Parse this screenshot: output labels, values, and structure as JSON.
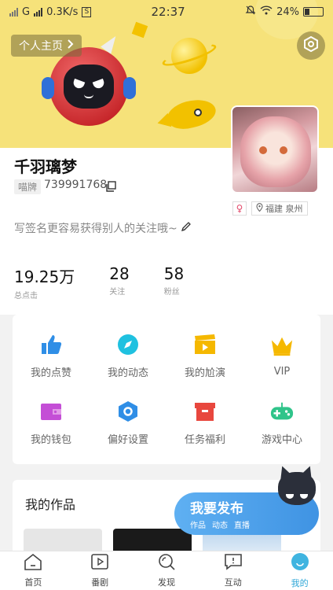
{
  "status_bar": {
    "network": "G",
    "speed": "0.3K/s",
    "s_badge": "S",
    "time": "22:37",
    "battery": "24%",
    "icons": [
      "signal-icon",
      "mute-bell-icon",
      "wifi-icon",
      "battery-icon"
    ]
  },
  "header": {
    "home_label": "个人主页",
    "settings_icon": "gear-icon"
  },
  "profile": {
    "username": "千羽璃梦",
    "tag": "喵牌",
    "uid": "739991768",
    "gender": "♀",
    "location": "福建 泉州",
    "signature": "写签名更容易获得别人的关注哦~"
  },
  "stats": [
    {
      "value": "19.25万",
      "label": "总点击"
    },
    {
      "value": "28",
      "label": "关注"
    },
    {
      "value": "58",
      "label": "粉丝"
    }
  ],
  "menu": [
    {
      "label": "我的点赞",
      "icon": "thumbs-up-icon",
      "color": "#2f8ee6"
    },
    {
      "label": "我的动态",
      "icon": "compass-icon",
      "color": "#1fc1e0"
    },
    {
      "label": "我的尬演",
      "icon": "clapperboard-icon",
      "color": "#f5b800"
    },
    {
      "label": "VIP",
      "icon": "crown-icon",
      "color": "#f5b800"
    },
    {
      "label": "我的钱包",
      "icon": "wallet-icon",
      "color": "#c44ed6"
    },
    {
      "label": "偏好设置",
      "icon": "hexagon-gear-icon",
      "color": "#2f8ee6"
    },
    {
      "label": "任务福利",
      "icon": "gift-box-icon",
      "color": "#e8473e"
    },
    {
      "label": "游戏中心",
      "icon": "gamepad-icon",
      "color": "#2fc48a"
    }
  ],
  "works": {
    "title": "我的作品"
  },
  "publish": {
    "label": "我要发布",
    "sub": [
      "作品",
      "动态",
      "直播"
    ]
  },
  "nav": [
    {
      "label": "首页",
      "icon": "home-icon"
    },
    {
      "label": "番剧",
      "icon": "play-square-icon"
    },
    {
      "label": "发现",
      "icon": "search-icon"
    },
    {
      "label": "互动",
      "icon": "message-icon"
    },
    {
      "label": "我的",
      "icon": "profile-circle-icon"
    }
  ],
  "colors": {
    "hero_bg": "#f6e27a",
    "accent": "#2fa7d8",
    "publish_bg": "#3f93e3"
  }
}
